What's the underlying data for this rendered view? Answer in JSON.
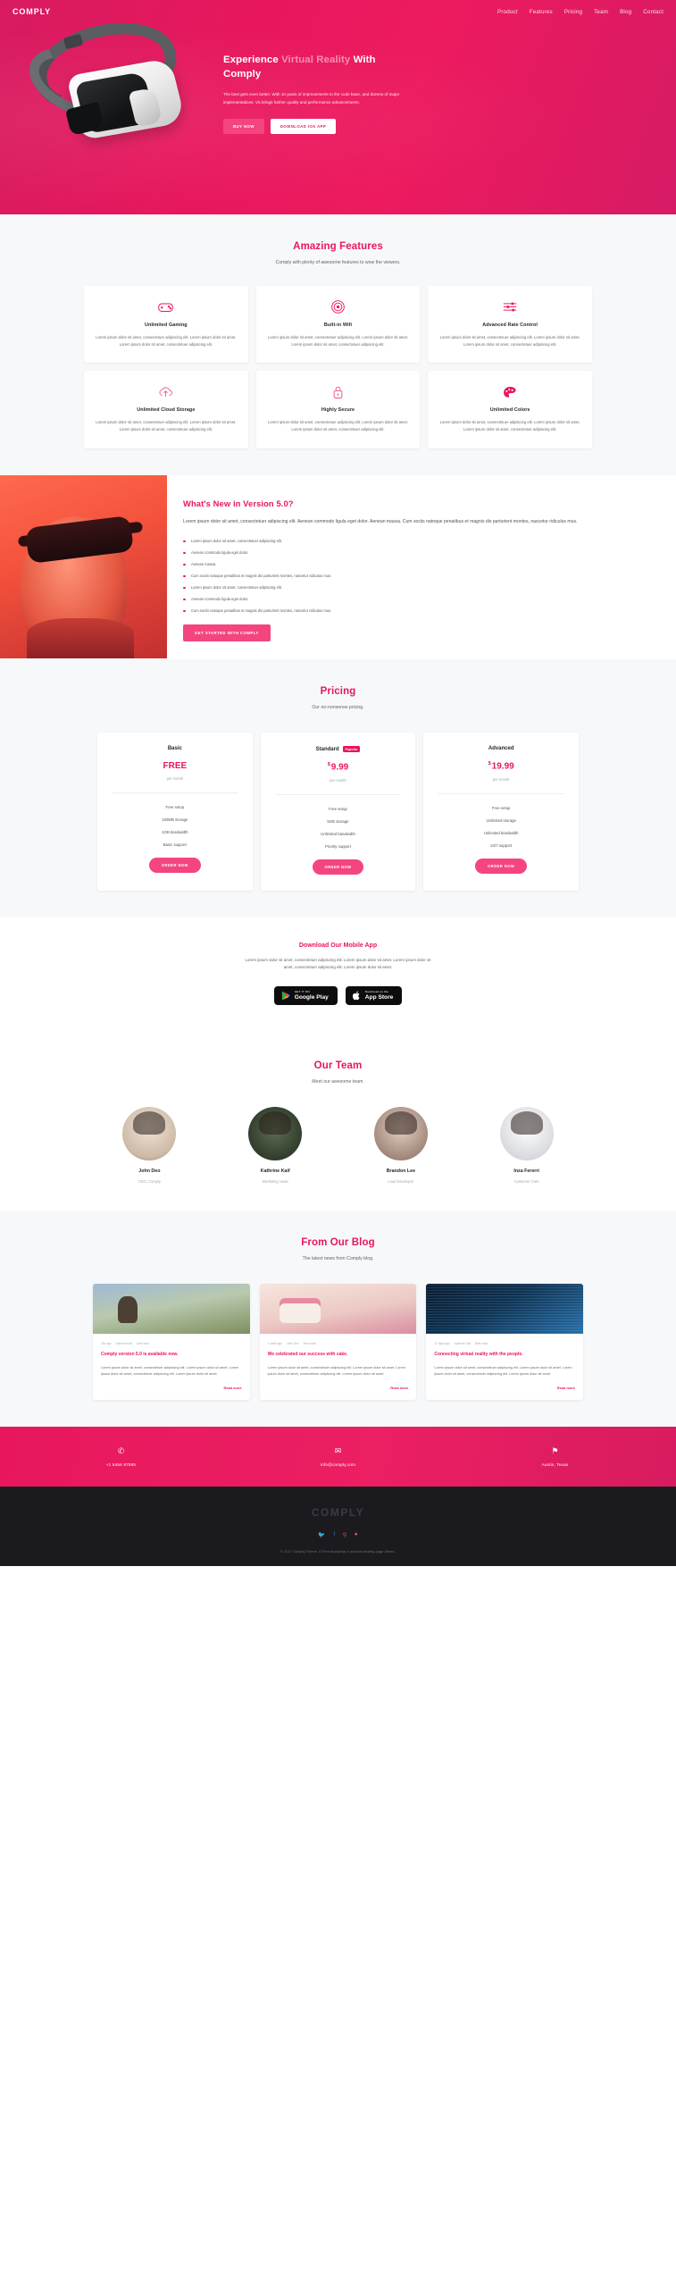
{
  "nav": {
    "logo": "COMPLY",
    "links": [
      "Product",
      "Features",
      "Pricing",
      "Team",
      "Blog",
      "Contact"
    ]
  },
  "hero": {
    "title_bold_1": "Experience ",
    "title_soft": "Virtual Reality",
    "title_bold_2": " With Comply",
    "paragraph": "The best gets even better. With 10 years of improvements to the code base, and dozens of major implementations. V5 brings further quality and performance advancements.",
    "btn_primary": "BUY NOW",
    "btn_secondary": "DOWNLOAD IOS APP"
  },
  "features": {
    "title": "Amazing Features",
    "subtitle": "Comply with plenty of awesome features to wow the viewers.",
    "body": "Lorem ipsum dolor sit amet, consectetuer adipiscing elit. Lorem ipsum dolor sit amet. Lorem ipsum dolor sit amet, consectetuer adipiscing elit.",
    "items": [
      {
        "icon": "gamepad-icon",
        "name": "Unlimited Gaming"
      },
      {
        "icon": "wifi-icon",
        "name": "Built-in Wifi"
      },
      {
        "icon": "sliders-icon",
        "name": "Advanced Rate Control"
      },
      {
        "icon": "cloud-upload-icon",
        "name": "Unlimited Cloud Storage"
      },
      {
        "icon": "lock-icon",
        "name": "Highly Secure"
      },
      {
        "icon": "palette-icon",
        "name": "Unlimited Colors"
      }
    ]
  },
  "whatsnew": {
    "title": "What's New in Version 5.0?",
    "paragraph": "Lorem ipsum dolor sit amet, consectetuer adipiscing elit. Aenean commodo ligula eget dolor. Aenean massa. Cum sociis natoque penatibus et magnis dis parturient montes, nascetur ridiculus mus.",
    "bullets": [
      "Lorem ipsum dolor sit amet, consectetuer adipiscing elit.",
      "Aenean commodo ligula eget dolor.",
      "Aenean massa.",
      "Cum sociis natoque penatibus et magnis dis parturient montes, nascetur ridiculus mus.",
      "Lorem ipsum dolor sit amet, consectetuer adipiscing elit.",
      "Aenean commodo ligula eget dolor.",
      "Cum sociis natoque penatibus et magnis dis parturient montes, nascetur ridiculus mus."
    ],
    "cta": "GET STARTED WITH COMPLY"
  },
  "pricing": {
    "title": "Pricing",
    "subtitle": "Our no-nonsense pricing.",
    "plans": [
      {
        "name": "Basic",
        "badge": "",
        "currency": "",
        "price": "FREE",
        "per": "per month",
        "features": [
          "Free setup",
          "100MB storage",
          "1GB bandwidth",
          "Basic support"
        ],
        "button": "ORDER NOW"
      },
      {
        "name": "Standard",
        "badge": "Popular",
        "currency": "$",
        "price": "9.99",
        "per": "per month",
        "features": [
          "Free setup",
          "5GB storage",
          "Unlimited bandwidth",
          "Priority support"
        ],
        "button": "ORDER NOW"
      },
      {
        "name": "Advanced",
        "badge": "",
        "currency": "$",
        "price": "19.99",
        "per": "per month",
        "features": [
          "Free setup",
          "Unlimited storage",
          "Unlimited bandwidth",
          "24/7 support"
        ],
        "button": "ORDER NOW"
      }
    ]
  },
  "app": {
    "title": "Download Our Mobile App",
    "description": "Lorem ipsum dolor sit amet, consectetuer adipiscing elit. Lorem ipsum dolor sit amet. Lorem ipsum dolor sit amet, consectetuer adipiscing elit. Lorem ipsum dolor sit amet.",
    "google": {
      "small": "GET IT ON",
      "big": "Google Play"
    },
    "apple": {
      "small": "Download on the",
      "big": "App Store"
    }
  },
  "team": {
    "title": "Our Team",
    "subtitle": "Meet our awesome team.",
    "members": [
      {
        "name": "John Deo",
        "role": "CEO, Comply"
      },
      {
        "name": "Kathrine Kaif",
        "role": "Marketing Head"
      },
      {
        "name": "Brandon Lee",
        "role": "Lead Developer"
      },
      {
        "name": "Inza Fererri",
        "role": "Customer Care"
      }
    ]
  },
  "blog": {
    "title": "From Our Blog",
    "subtitle": "The latest news from Comply blog.",
    "posts": [
      {
        "time": "23h ago",
        "author": "Kathrine Kaif",
        "read": "2min read",
        "title": "Comply version 5.0 is available now.",
        "text": "Lorem ipsum dolor sit amet, consectetuer adipiscing elit. Lorem ipsum dolor sit amet. Lorem ipsum dolor sit amet, consectetuer adipiscing elit. Lorem ipsum dolor sit amet.",
        "more": "Read more"
      },
      {
        "time": "1 week ago",
        "author": "John Deo",
        "read": "5min read",
        "title": "We celebrated our success with cake.",
        "text": "Lorem ipsum dolor sit amet, consectetuer adipiscing elit. Lorem ipsum dolor sit amet. Lorem ipsum dolor sit amet, consectetuer adipiscing elit. Lorem ipsum dolor sit amet.",
        "more": "Read more"
      },
      {
        "time": "17 days ago",
        "author": "Kathrine Kaif",
        "read": "8min read",
        "title": "Connecting virtual reality with the people.",
        "text": "Lorem ipsum dolor sit amet, consectetuer adipiscing elit. Lorem ipsum dolor sit amet. Lorem ipsum dolor sit amet, consectetuer adipiscing elit. Lorem ipsum dolor sit amet.",
        "more": "Read more"
      }
    ]
  },
  "contact": {
    "items": [
      {
        "icon": "phone-icon",
        "glyph": "✆",
        "text": "+1 5456 87595"
      },
      {
        "icon": "envelope-icon",
        "glyph": "✉",
        "text": "info@comply.com"
      },
      {
        "icon": "map-pin-icon",
        "glyph": "⚑",
        "text": "Austin, Texas"
      }
    ]
  },
  "footer": {
    "logo": "COMPLY",
    "socials": [
      {
        "icon": "twitter-icon",
        "glyph": "🐦",
        "color": "#3aa5e0"
      },
      {
        "icon": "facebook-icon",
        "glyph": "f",
        "color": "#4267b2"
      },
      {
        "icon": "google-plus-icon",
        "glyph": "g",
        "color": "#db4437"
      },
      {
        "icon": "dribbble-icon",
        "glyph": "●",
        "color": "#ea4c89"
      }
    ],
    "copyright": "© 2017 Comply Theme. A Free Bootstrap 4 product landing page theme."
  },
  "colors": {
    "brand_pink": "#e8175d",
    "accent_pink": "#f4457f",
    "dark": "#1b1b1f"
  }
}
